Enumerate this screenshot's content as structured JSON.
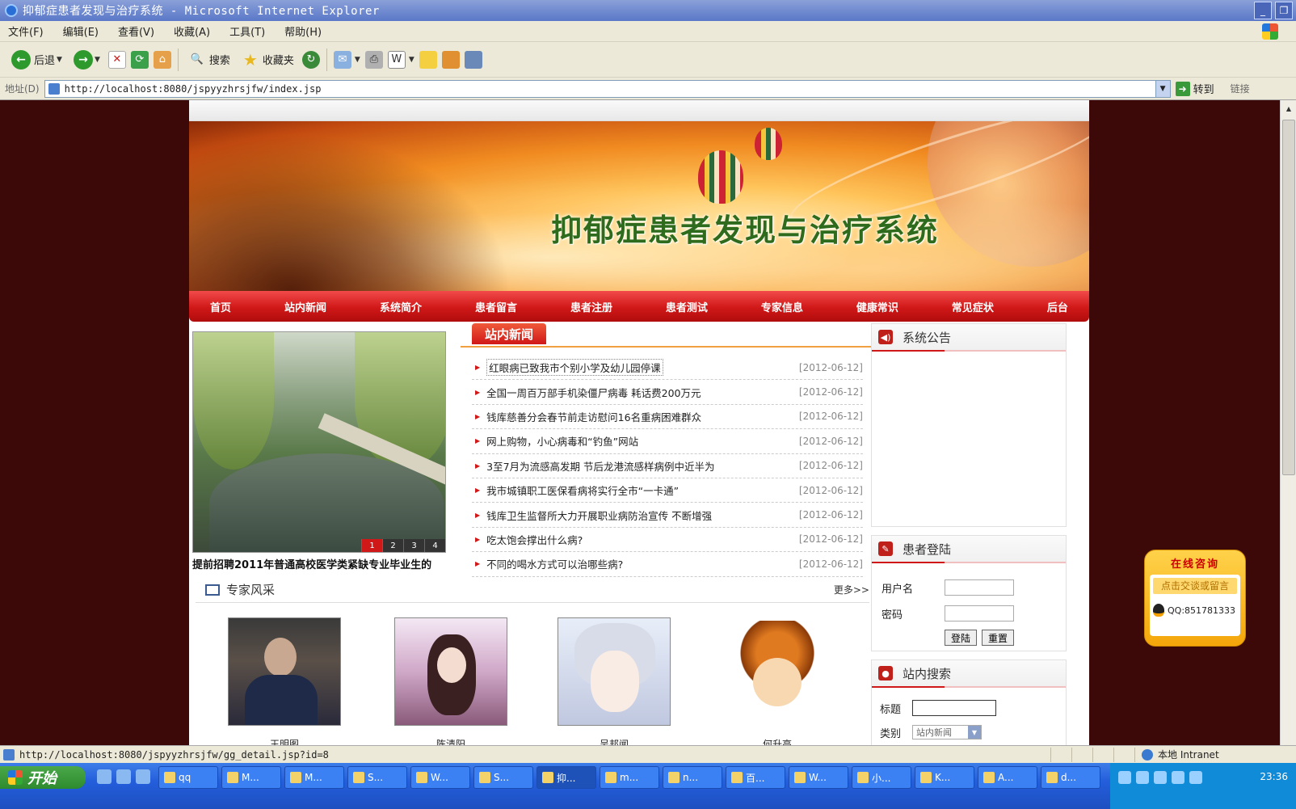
{
  "window": {
    "title": "抑郁症患者发现与治疗系统 - Microsoft Internet Explorer"
  },
  "menu": [
    "文件(F)",
    "编辑(E)",
    "查看(V)",
    "收藏(A)",
    "工具(T)",
    "帮助(H)"
  ],
  "toolbar": {
    "back": "后退",
    "search": "搜索",
    "favorites": "收藏夹"
  },
  "address": {
    "label": "地址(D)",
    "url": "http://localhost:8080/jspyyzhrsjfw/index.jsp",
    "go": "转到",
    "links": "链接"
  },
  "site": {
    "title": "抑郁症患者发现与治疗系统"
  },
  "nav": [
    "首页",
    "站内新闻",
    "系统简介",
    "患者留言",
    "患者注册",
    "患者测试",
    "专家信息",
    "健康常识",
    "常见症状",
    "后台"
  ],
  "slideshow": {
    "pages": [
      "1",
      "2",
      "3",
      "4"
    ],
    "active": "1",
    "caption": "提前招聘2011年普通高校医学类紧缺专业毕业生的"
  },
  "news": {
    "tab": "站内新闻",
    "items": [
      {
        "title": "红眼病已致我市个别小学及幼儿园停课",
        "date": "[2012-06-12]"
      },
      {
        "title": "全国一周百万部手机染僵尸病毒 耗话费200万元",
        "date": "[2012-06-12]"
      },
      {
        "title": "钱库慈善分会春节前走访慰问16名重病困难群众",
        "date": "[2012-06-12]"
      },
      {
        "title": "网上购物，小心病毒和“钓鱼”网站",
        "date": "[2012-06-12]"
      },
      {
        "title": "3至7月为流感高发期 节后龙港流感样病例中近半为",
        "date": "[2012-06-12]"
      },
      {
        "title": "我市城镇职工医保看病将实行全市“一卡通”",
        "date": "[2012-06-12]"
      },
      {
        "title": "钱库卫生监督所大力开展职业病防治宣传 不断增强",
        "date": "[2012-06-12]"
      },
      {
        "title": "吃太饱会撑出什么病?",
        "date": "[2012-06-12]"
      },
      {
        "title": "不同的喝水方式可以治哪些病?",
        "date": "[2012-06-12]"
      }
    ]
  },
  "experts": {
    "title": "专家风采",
    "more": "更多>>",
    "people": [
      {
        "name": "王明图"
      },
      {
        "name": "陈清阳"
      },
      {
        "name": "吴邦闻"
      },
      {
        "name": "何升高"
      }
    ]
  },
  "notice": {
    "title": "系统公告"
  },
  "login": {
    "title": "患者登陆",
    "username_label": "用户名",
    "password_label": "密码",
    "login_btn": "登陆",
    "reset_btn": "重置"
  },
  "search": {
    "title": "站内搜索",
    "title_label": "标题",
    "category_label": "类别",
    "category_value": "站内新闻"
  },
  "consult": {
    "title": "在线咨询",
    "leave_msg": "点击交谈或留言",
    "qq": "QQ:851781333"
  },
  "status": {
    "url": "http://localhost:8080/jspyyzhrsjfw/gg_detail.jsp?id=8",
    "zone": "本地 Intranet"
  },
  "taskbar": {
    "start": "开始",
    "tasks": [
      "qq",
      "M...",
      "M...",
      "S...",
      "W...",
      "S...",
      "抑...",
      "m...",
      "n...",
      "百...",
      "W...",
      "小...",
      "K...",
      "A...",
      "d..."
    ],
    "active_task": "抑...",
    "clock": "23:36"
  }
}
